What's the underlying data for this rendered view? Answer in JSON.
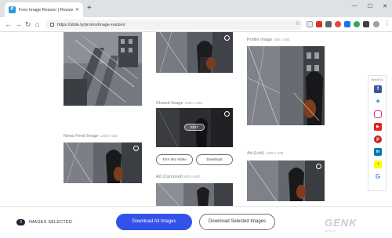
{
  "browser": {
    "tab_title": "Free Image Resizer | Resize Your",
    "url": "https://slide.ly/promo/image-resizer/",
    "new_tab_glyph": "+",
    "close_glyph": "✕"
  },
  "content": {
    "captions": {
      "shared": {
        "name": "Shared Image",
        "size": "1200 x 600"
      },
      "profile": {
        "name": "Profile Image",
        "size": "180 x 180"
      },
      "news_feed": {
        "name": "News Feed Image",
        "size": "1200 x 628"
      },
      "ad_link": {
        "name": "Ad (Link)",
        "size": "1200 x 628"
      },
      "ad_carousel": {
        "name": "Ad (Carousel)",
        "size": "600 x 600"
      }
    },
    "edit_label": "EDIT",
    "turn_into_video": "Turn Into Video",
    "download": "Download"
  },
  "share_rail": {
    "title": "Scroll To",
    "icons": [
      "facebook-icon",
      "twitter-icon",
      "instagram-icon",
      "youtube-icon",
      "pinterest-icon",
      "linkedin-icon",
      "snapchat-icon",
      "google-icon"
    ]
  },
  "footer": {
    "selected_count": "3",
    "selected_label": "IMAGES SELECTED",
    "download_all": "Download All Images",
    "download_selected": "Download Selected Images",
    "watermark": "GENK",
    "watermark_sub": "genk.vn"
  },
  "colors": {
    "primary_button": "#3352ea",
    "tab_strip": "#dee1e6"
  }
}
